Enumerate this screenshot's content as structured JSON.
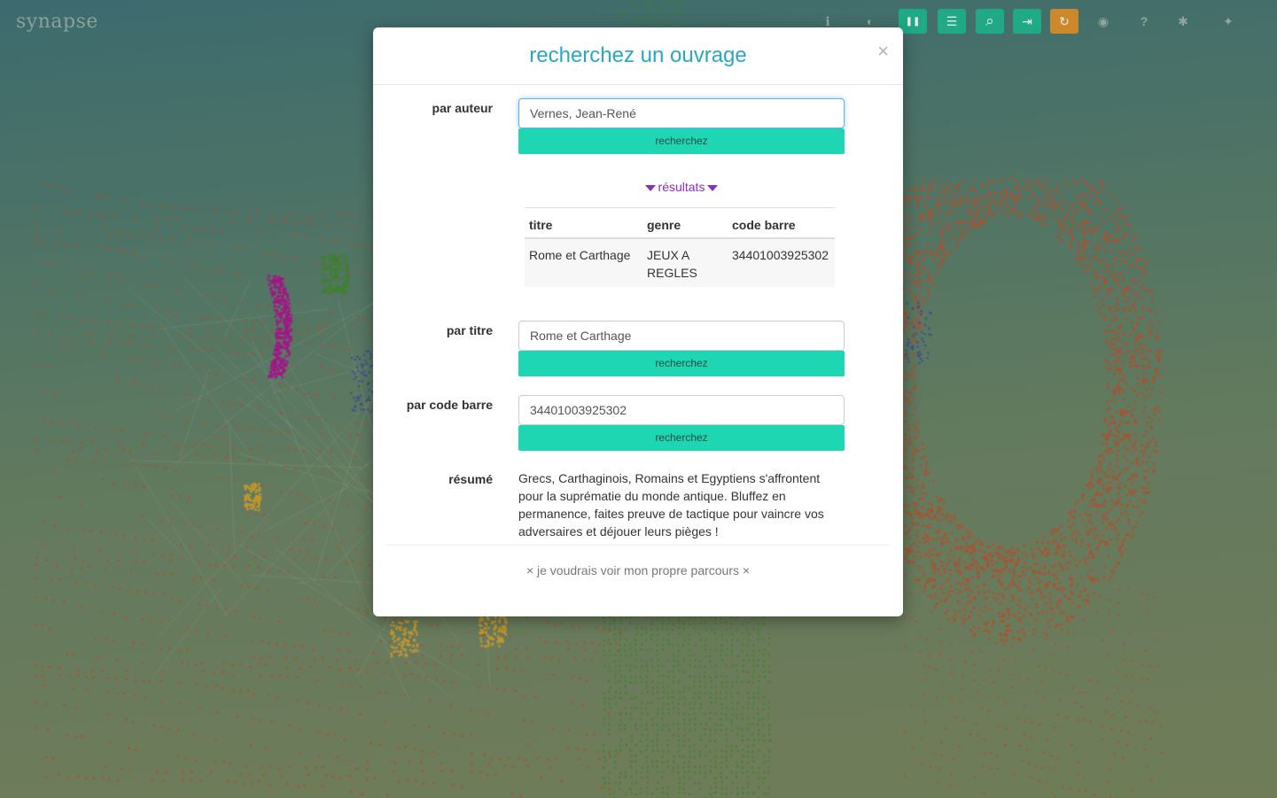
{
  "app": {
    "logo_text": "synapse"
  },
  "toolbar": {
    "buttons": [
      {
        "name": "info-icon",
        "glyph": "ℹ"
      },
      {
        "name": "toggle-icon",
        "glyph": "◐"
      },
      {
        "name": "pause-icon",
        "glyph": "❚❚"
      },
      {
        "name": "sliders-icon",
        "glyph": "☰"
      },
      {
        "name": "search-icon",
        "glyph": "⌕"
      },
      {
        "name": "login-icon",
        "glyph": "⇥"
      },
      {
        "name": "refresh-icon",
        "glyph": "↻"
      },
      {
        "name": "camera-icon",
        "glyph": "◉"
      },
      {
        "name": "help-icon",
        "glyph": "?"
      },
      {
        "name": "asterisk-icon",
        "glyph": "✱"
      },
      {
        "name": "twitter-icon",
        "glyph": "✦"
      }
    ]
  },
  "modal": {
    "title": "recherchez un ouvrage",
    "close_label": "×",
    "author": {
      "label": "par auteur",
      "value": "Vernes, Jean-René",
      "button": "recherchez"
    },
    "results": {
      "toggle_label": "résultats",
      "columns": [
        "titre",
        "genre",
        "code barre"
      ],
      "rows": [
        {
          "titre": "Rome et Carthage",
          "genre": "JEUX A REGLES",
          "code_barre": "34401003925302"
        }
      ]
    },
    "title_search": {
      "label": "par titre",
      "value": "Rome et Carthage",
      "button": "recherchez"
    },
    "barcode_search": {
      "label": "par code barre",
      "value": "34401003925302",
      "button": "recherchez"
    },
    "summary": {
      "label": "résumé",
      "text": "Grecs, Carthaginois, Romains et Egyptiens s'affrontent pour la suprématie du monde antique. Bluffez en permanence, faites preuve de tactique pour vaincre vos adversaires et déjouer leurs pièges !"
    },
    "footer_link": "× je voudrais voir mon propre parcours ×"
  },
  "colors": {
    "accent_teal": "#1ed6b2",
    "title_blue": "#2ba6c4",
    "results_purple": "#8a2fc0",
    "toolbar_green": "#1fb58f",
    "toolbar_orange": "#e0902a",
    "dots_red": "#c0502a",
    "dots_green": "#3f8a22",
    "dots_magenta": "#b01290"
  }
}
